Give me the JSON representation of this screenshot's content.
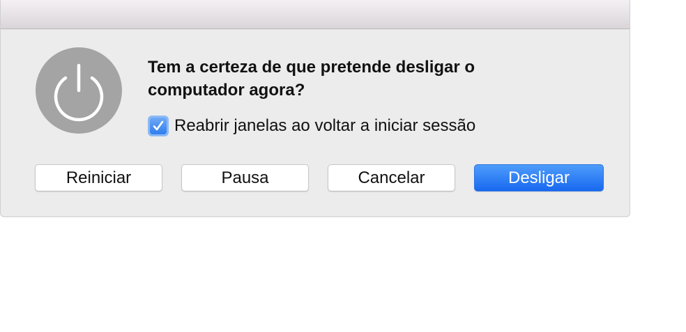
{
  "dialog": {
    "question": "Tem a certeza de que pretende desligar o computador agora?",
    "checkbox": {
      "label": "Reabrir janelas ao voltar a iniciar sessão",
      "checked": true
    },
    "buttons": {
      "restart": "Reiniciar",
      "sleep": "Pausa",
      "cancel": "Cancelar",
      "shutdown": "Desligar"
    },
    "icon": "power-icon"
  },
  "colors": {
    "dialog_bg": "#ececec",
    "accent": "#1869f0",
    "icon_bg": "#a4a4a4"
  }
}
